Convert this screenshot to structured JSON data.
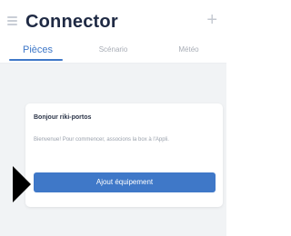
{
  "header": {
    "title": "Connector",
    "menu_icon": "hamburger-menu-icon",
    "add_icon": "plus-icon",
    "add_glyph": "+"
  },
  "tabs": [
    {
      "label": "Pièces",
      "active": true
    },
    {
      "label": "Scénario",
      "active": false
    },
    {
      "label": "Météo",
      "active": false
    }
  ],
  "card": {
    "title": "Bonjour riki-portos",
    "text": "Bienvenue! Pour commencer, associons la box à l'Appli.",
    "button_label": "Ajout équipement"
  },
  "colors": {
    "accent": "#3f78c8",
    "title": "#1f2a44",
    "background": "#f1f3f5",
    "pointer": "#000000"
  }
}
